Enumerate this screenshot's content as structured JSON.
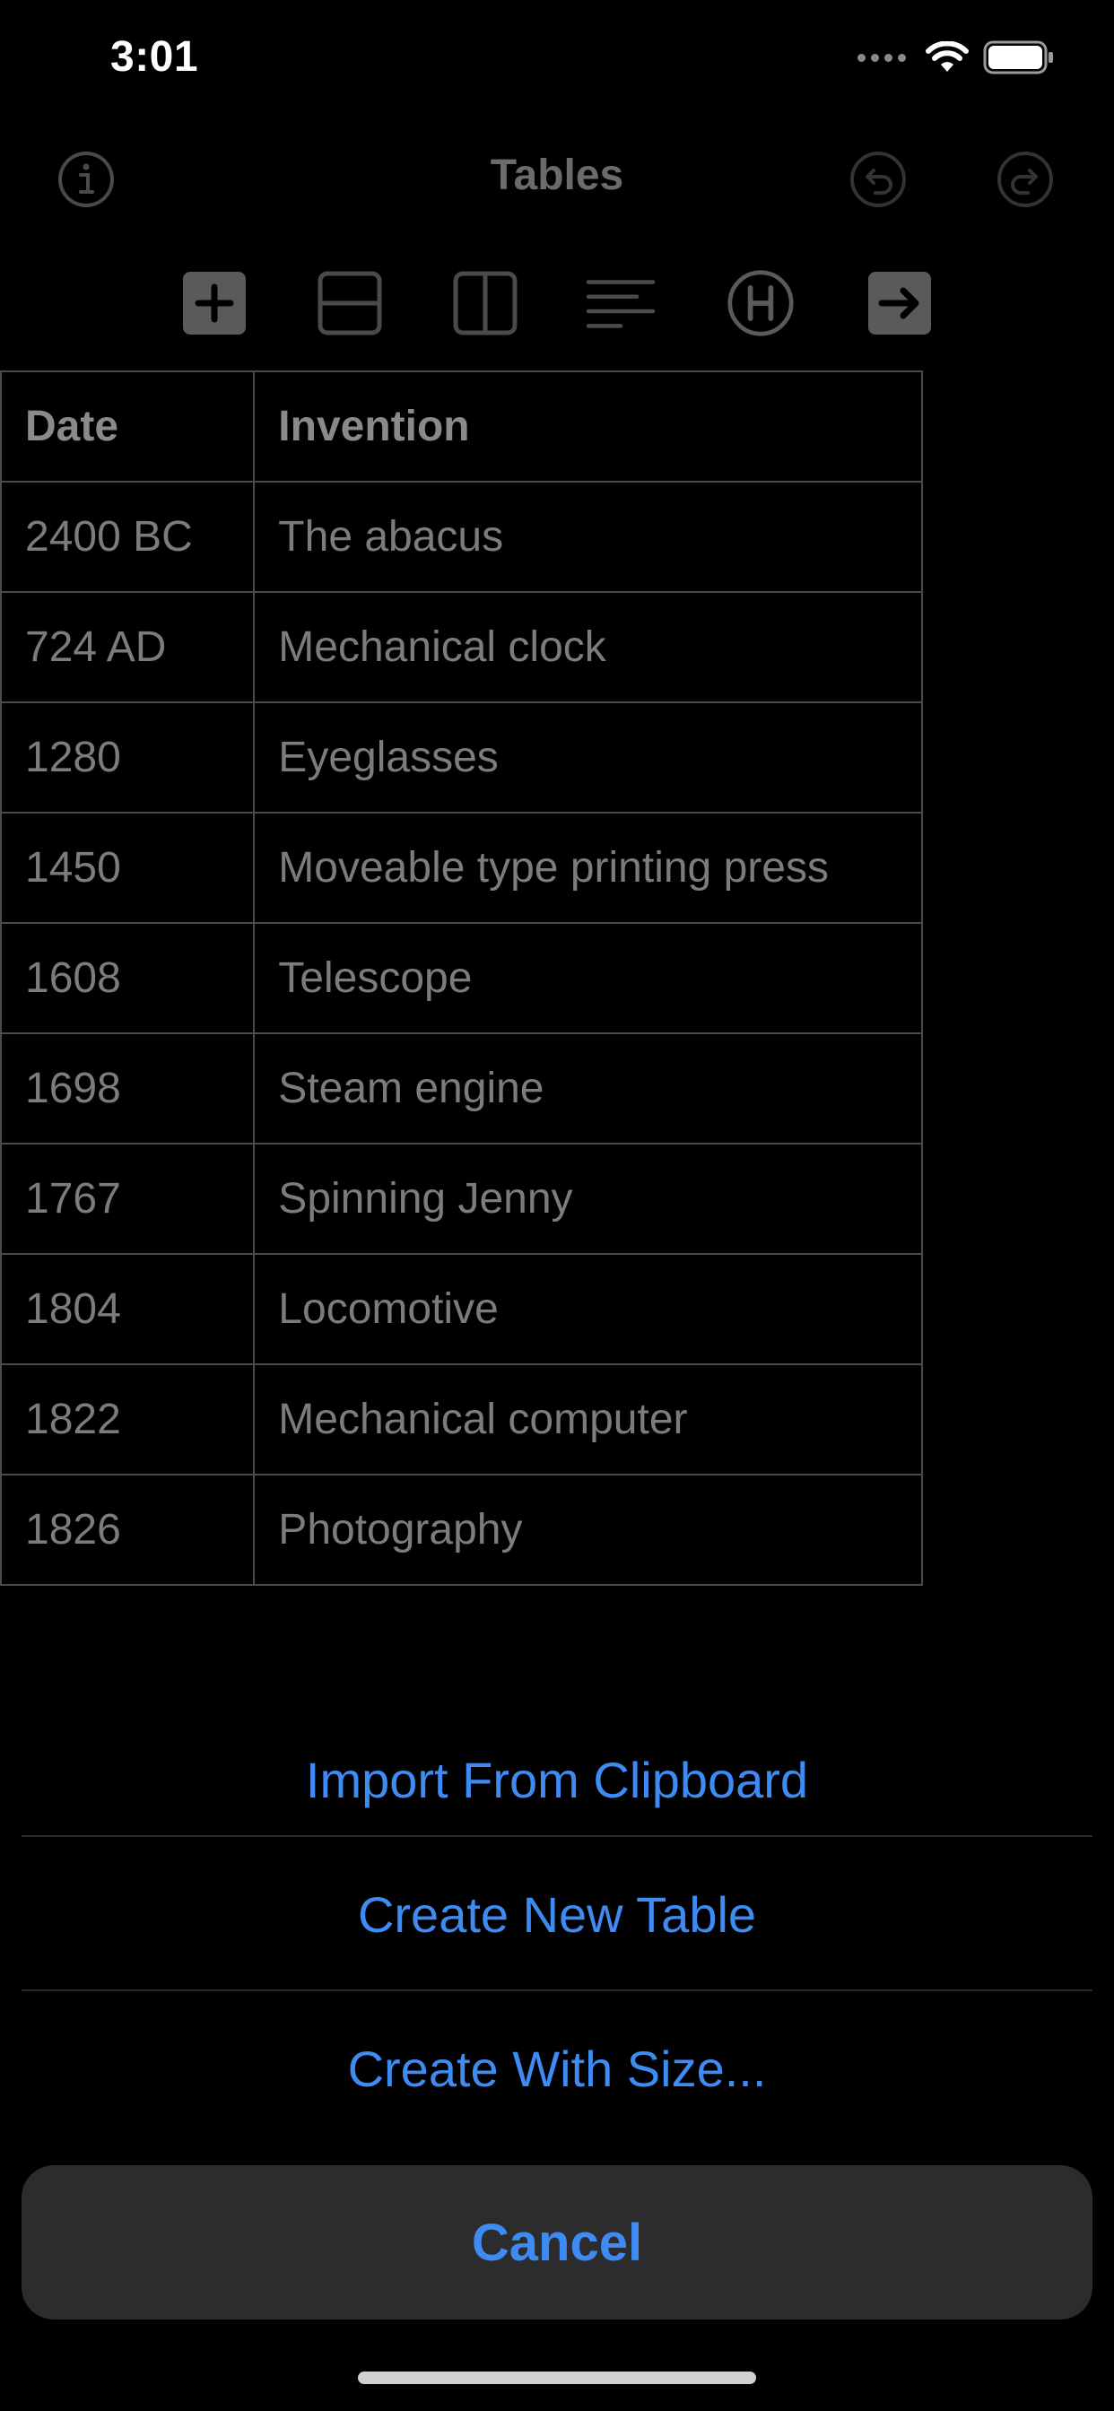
{
  "status_bar": {
    "time": "3:01"
  },
  "nav": {
    "title": "Tables",
    "icons": [
      "info-icon",
      "undo-icon",
      "redo-icon"
    ]
  },
  "toolbar": {
    "icons": [
      "add-icon",
      "row-icon",
      "column-icon",
      "align-icon",
      "header-icon",
      "arrow-right-icon"
    ]
  },
  "table": {
    "headers": [
      "Date",
      "Invention"
    ],
    "rows": [
      [
        "2400 BC",
        "The abacus"
      ],
      [
        "724 AD",
        "Mechanical clock"
      ],
      [
        "1280",
        "Eyeglasses"
      ],
      [
        "1450",
        "Moveable type printing press"
      ],
      [
        "1608",
        "Telescope"
      ],
      [
        "1698",
        "Steam engine"
      ],
      [
        "1767",
        "Spinning Jenny"
      ],
      [
        "1804",
        "Locomotive"
      ],
      [
        "1822",
        "Mechanical computer"
      ],
      [
        "1826",
        "Photography"
      ]
    ]
  },
  "action_sheet": {
    "items": [
      "Import From Clipboard",
      "Create New Table",
      "Create With Size..."
    ],
    "cancel": "Cancel"
  },
  "colors": {
    "accent": "#3e8bf3",
    "background": "#000000",
    "dimmed_text": "#7c7c7c"
  }
}
